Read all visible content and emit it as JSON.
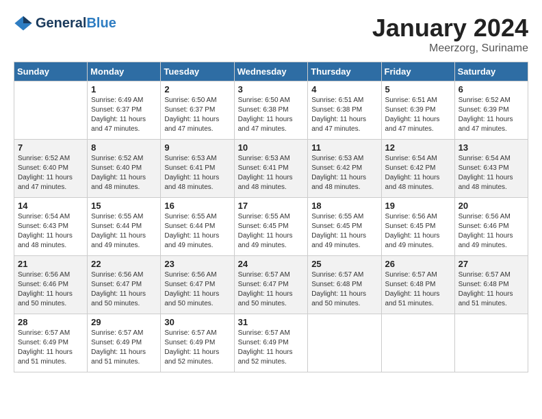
{
  "header": {
    "logo_line1": "General",
    "logo_line2": "Blue",
    "month_title": "January 2024",
    "location": "Meerzorg, Suriname"
  },
  "days_of_week": [
    "Sunday",
    "Monday",
    "Tuesday",
    "Wednesday",
    "Thursday",
    "Friday",
    "Saturday"
  ],
  "weeks": [
    [
      {
        "day": "",
        "sunrise": "",
        "sunset": "",
        "daylight": ""
      },
      {
        "day": "1",
        "sunrise": "Sunrise: 6:49 AM",
        "sunset": "Sunset: 6:37 PM",
        "daylight": "Daylight: 11 hours and 47 minutes."
      },
      {
        "day": "2",
        "sunrise": "Sunrise: 6:50 AM",
        "sunset": "Sunset: 6:37 PM",
        "daylight": "Daylight: 11 hours and 47 minutes."
      },
      {
        "day": "3",
        "sunrise": "Sunrise: 6:50 AM",
        "sunset": "Sunset: 6:38 PM",
        "daylight": "Daylight: 11 hours and 47 minutes."
      },
      {
        "day": "4",
        "sunrise": "Sunrise: 6:51 AM",
        "sunset": "Sunset: 6:38 PM",
        "daylight": "Daylight: 11 hours and 47 minutes."
      },
      {
        "day": "5",
        "sunrise": "Sunrise: 6:51 AM",
        "sunset": "Sunset: 6:39 PM",
        "daylight": "Daylight: 11 hours and 47 minutes."
      },
      {
        "day": "6",
        "sunrise": "Sunrise: 6:52 AM",
        "sunset": "Sunset: 6:39 PM",
        "daylight": "Daylight: 11 hours and 47 minutes."
      }
    ],
    [
      {
        "day": "7",
        "sunrise": "Sunrise: 6:52 AM",
        "sunset": "Sunset: 6:40 PM",
        "daylight": "Daylight: 11 hours and 47 minutes."
      },
      {
        "day": "8",
        "sunrise": "Sunrise: 6:52 AM",
        "sunset": "Sunset: 6:40 PM",
        "daylight": "Daylight: 11 hours and 48 minutes."
      },
      {
        "day": "9",
        "sunrise": "Sunrise: 6:53 AM",
        "sunset": "Sunset: 6:41 PM",
        "daylight": "Daylight: 11 hours and 48 minutes."
      },
      {
        "day": "10",
        "sunrise": "Sunrise: 6:53 AM",
        "sunset": "Sunset: 6:41 PM",
        "daylight": "Daylight: 11 hours and 48 minutes."
      },
      {
        "day": "11",
        "sunrise": "Sunrise: 6:53 AM",
        "sunset": "Sunset: 6:42 PM",
        "daylight": "Daylight: 11 hours and 48 minutes."
      },
      {
        "day": "12",
        "sunrise": "Sunrise: 6:54 AM",
        "sunset": "Sunset: 6:42 PM",
        "daylight": "Daylight: 11 hours and 48 minutes."
      },
      {
        "day": "13",
        "sunrise": "Sunrise: 6:54 AM",
        "sunset": "Sunset: 6:43 PM",
        "daylight": "Daylight: 11 hours and 48 minutes."
      }
    ],
    [
      {
        "day": "14",
        "sunrise": "Sunrise: 6:54 AM",
        "sunset": "Sunset: 6:43 PM",
        "daylight": "Daylight: 11 hours and 48 minutes."
      },
      {
        "day": "15",
        "sunrise": "Sunrise: 6:55 AM",
        "sunset": "Sunset: 6:44 PM",
        "daylight": "Daylight: 11 hours and 49 minutes."
      },
      {
        "day": "16",
        "sunrise": "Sunrise: 6:55 AM",
        "sunset": "Sunset: 6:44 PM",
        "daylight": "Daylight: 11 hours and 49 minutes."
      },
      {
        "day": "17",
        "sunrise": "Sunrise: 6:55 AM",
        "sunset": "Sunset: 6:45 PM",
        "daylight": "Daylight: 11 hours and 49 minutes."
      },
      {
        "day": "18",
        "sunrise": "Sunrise: 6:55 AM",
        "sunset": "Sunset: 6:45 PM",
        "daylight": "Daylight: 11 hours and 49 minutes."
      },
      {
        "day": "19",
        "sunrise": "Sunrise: 6:56 AM",
        "sunset": "Sunset: 6:45 PM",
        "daylight": "Daylight: 11 hours and 49 minutes."
      },
      {
        "day": "20",
        "sunrise": "Sunrise: 6:56 AM",
        "sunset": "Sunset: 6:46 PM",
        "daylight": "Daylight: 11 hours and 49 minutes."
      }
    ],
    [
      {
        "day": "21",
        "sunrise": "Sunrise: 6:56 AM",
        "sunset": "Sunset: 6:46 PM",
        "daylight": "Daylight: 11 hours and 50 minutes."
      },
      {
        "day": "22",
        "sunrise": "Sunrise: 6:56 AM",
        "sunset": "Sunset: 6:47 PM",
        "daylight": "Daylight: 11 hours and 50 minutes."
      },
      {
        "day": "23",
        "sunrise": "Sunrise: 6:56 AM",
        "sunset": "Sunset: 6:47 PM",
        "daylight": "Daylight: 11 hours and 50 minutes."
      },
      {
        "day": "24",
        "sunrise": "Sunrise: 6:57 AM",
        "sunset": "Sunset: 6:47 PM",
        "daylight": "Daylight: 11 hours and 50 minutes."
      },
      {
        "day": "25",
        "sunrise": "Sunrise: 6:57 AM",
        "sunset": "Sunset: 6:48 PM",
        "daylight": "Daylight: 11 hours and 50 minutes."
      },
      {
        "day": "26",
        "sunrise": "Sunrise: 6:57 AM",
        "sunset": "Sunset: 6:48 PM",
        "daylight": "Daylight: 11 hours and 51 minutes."
      },
      {
        "day": "27",
        "sunrise": "Sunrise: 6:57 AM",
        "sunset": "Sunset: 6:48 PM",
        "daylight": "Daylight: 11 hours and 51 minutes."
      }
    ],
    [
      {
        "day": "28",
        "sunrise": "Sunrise: 6:57 AM",
        "sunset": "Sunset: 6:49 PM",
        "daylight": "Daylight: 11 hours and 51 minutes."
      },
      {
        "day": "29",
        "sunrise": "Sunrise: 6:57 AM",
        "sunset": "Sunset: 6:49 PM",
        "daylight": "Daylight: 11 hours and 51 minutes."
      },
      {
        "day": "30",
        "sunrise": "Sunrise: 6:57 AM",
        "sunset": "Sunset: 6:49 PM",
        "daylight": "Daylight: 11 hours and 52 minutes."
      },
      {
        "day": "31",
        "sunrise": "Sunrise: 6:57 AM",
        "sunset": "Sunset: 6:49 PM",
        "daylight": "Daylight: 11 hours and 52 minutes."
      },
      {
        "day": "",
        "sunrise": "",
        "sunset": "",
        "daylight": ""
      },
      {
        "day": "",
        "sunrise": "",
        "sunset": "",
        "daylight": ""
      },
      {
        "day": "",
        "sunrise": "",
        "sunset": "",
        "daylight": ""
      }
    ]
  ]
}
